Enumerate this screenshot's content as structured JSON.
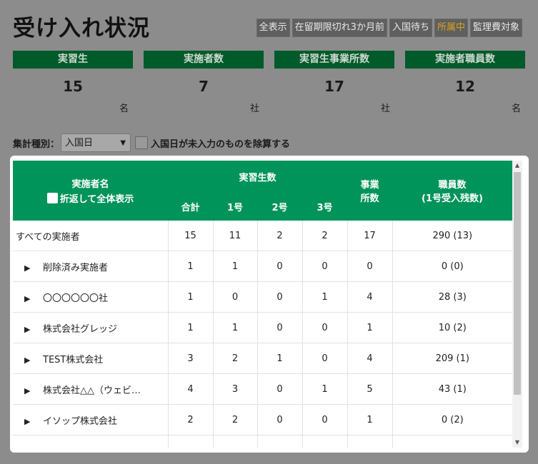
{
  "title": "受け入れ状況",
  "filters": [
    {
      "label": "全表示",
      "active": false
    },
    {
      "label": "在留期限切れ3か月前",
      "active": false
    },
    {
      "label": "入国待ち",
      "active": false
    },
    {
      "label": "所属中",
      "active": true
    },
    {
      "label": "監理費対象",
      "active": false
    }
  ],
  "stats": [
    {
      "label": "実習生",
      "value": "15",
      "unit": "名"
    },
    {
      "label": "実施者数",
      "value": "7",
      "unit": "社"
    },
    {
      "label": "実習生事業所数",
      "value": "17",
      "unit": "社"
    },
    {
      "label": "実施者職員数",
      "value": "12",
      "unit": "名"
    }
  ],
  "aggregation": {
    "label": "集計種別：",
    "selected": "入国日",
    "exclude_label": "入国日が未入力のものを除算する"
  },
  "table": {
    "header": {
      "name": "実施者名",
      "collapse_label": "折返して全体表示",
      "trainees": "実習生数",
      "total": "合計",
      "no1": "1号",
      "no2": "2号",
      "no3": "3号",
      "offices_line1": "事業",
      "offices_line2": "所数",
      "staff_line1": "職員数",
      "staff_line2": "(1号受入残数)"
    },
    "rows": [
      {
        "name": "すべての実施者",
        "expandable": false,
        "total": "15",
        "no1": "11",
        "no2": "2",
        "no3": "2",
        "offices": "17",
        "staff": "290 (13)"
      },
      {
        "name": "削除済み実施者",
        "expandable": true,
        "total": "1",
        "no1": "1",
        "no2": "0",
        "no3": "0",
        "offices": "0",
        "staff": "0 (0)"
      },
      {
        "name": "〇〇〇〇〇〇社",
        "expandable": true,
        "total": "1",
        "no1": "0",
        "no2": "0",
        "no3": "1",
        "offices": "4",
        "staff": "28 (3)"
      },
      {
        "name": "株式会社グレッジ",
        "expandable": true,
        "total": "1",
        "no1": "1",
        "no2": "0",
        "no3": "0",
        "offices": "1",
        "staff": "10 (2)"
      },
      {
        "name": "TEST株式会社",
        "expandable": true,
        "total": "3",
        "no1": "2",
        "no2": "1",
        "no3": "0",
        "offices": "4",
        "staff": "209 (1)"
      },
      {
        "name": "株式会社△△（ウェビ…",
        "expandable": true,
        "total": "4",
        "no1": "3",
        "no2": "0",
        "no3": "1",
        "offices": "5",
        "staff": "43 (1)"
      },
      {
        "name": "イソップ株式会社",
        "expandable": true,
        "total": "2",
        "no1": "2",
        "no2": "0",
        "no3": "0",
        "offices": "1",
        "staff": "0 (2)"
      },
      {
        "name": "",
        "expandable": false,
        "total": "",
        "no1": "",
        "no2": "",
        "no3": "",
        "offices": "",
        "staff": ""
      }
    ]
  },
  "colors": {
    "header_green": "#00935a",
    "card_header_green": "#005a2a",
    "overlay_gray": "#8c8c8c",
    "active_filter": "#d8a21f"
  }
}
